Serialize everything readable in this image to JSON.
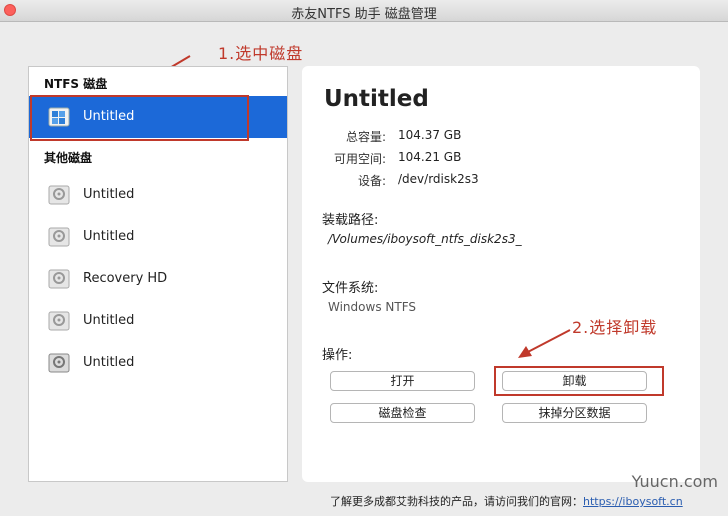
{
  "window": {
    "title": "赤友NTFS 助手 磁盘管理"
  },
  "annotations": {
    "step1": "1.选中磁盘",
    "step2": "2.选择卸载"
  },
  "sidebar": {
    "ntfs_header": "NTFS 磁盘",
    "ntfs_items": [
      {
        "label": "Untitled",
        "icon": "ntfs-disk-icon"
      }
    ],
    "other_header": "其他磁盘",
    "other_items": [
      {
        "label": "Untitled",
        "icon": "disk-icon"
      },
      {
        "label": "Untitled",
        "icon": "disk-icon"
      },
      {
        "label": "Recovery HD",
        "icon": "disk-icon"
      },
      {
        "label": "Untitled",
        "icon": "disk-icon"
      },
      {
        "label": "Untitled",
        "icon": "disk-icon"
      }
    ]
  },
  "detail": {
    "title": "Untitled",
    "capacity_label": "总容量:",
    "capacity_value": "104.37 GB",
    "available_label": "可用空间:",
    "available_value": "104.21 GB",
    "device_label": "设备:",
    "device_value": "/dev/rdisk2s3",
    "mount_label": "装载路径:",
    "mount_value": "/Volumes/iboysoft_ntfs_disk2s3_",
    "fs_label": "文件系统:",
    "fs_value": "Windows NTFS",
    "actions_label": "操作:",
    "buttons": {
      "open": "打开",
      "unmount": "卸载",
      "check": "磁盘检查",
      "erase": "抹掉分区数据"
    }
  },
  "footer": {
    "text": "了解更多成都艾勃科技的产品，请访问我们的官网：",
    "link": "https://iboysoft.cn"
  },
  "watermark": "Yuucn.com",
  "colors": {
    "selection": "#1c69d8",
    "annotation": "#c0392b"
  }
}
